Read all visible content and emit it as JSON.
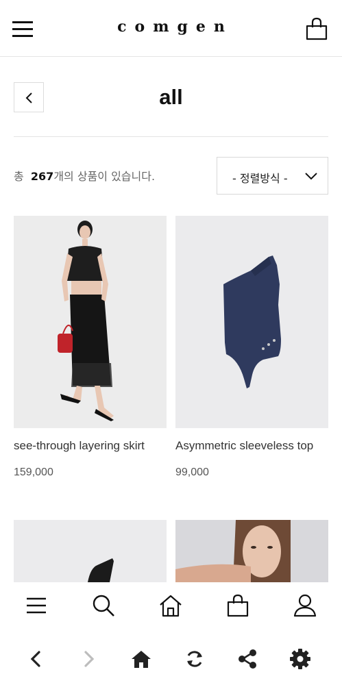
{
  "header": {
    "logo": "comgen"
  },
  "page": {
    "title": "all"
  },
  "listing": {
    "count_prefix": "총",
    "count": "267",
    "count_suffix": "개의 상품이 있습니다.",
    "sort_label": "- 정렬방식 -"
  },
  "products": [
    {
      "name": "see-through layering skirt",
      "price": "159,000"
    },
    {
      "name": "Asymmetric sleeveless top",
      "price": "99,000"
    },
    {
      "name": "",
      "price": ""
    },
    {
      "name": "",
      "price": ""
    }
  ],
  "icons": {
    "menu": "hamburger-menu-icon",
    "cart": "shopping-bag-icon",
    "back": "chevron-left-icon",
    "sort": "chevron-down-icon",
    "bottom_nav": [
      "hamburger-menu-icon",
      "search-icon",
      "home-icon",
      "shopping-bag-icon",
      "user-icon"
    ],
    "browser": [
      "chevron-left-icon",
      "chevron-right-icon",
      "home-icon",
      "refresh-icon",
      "share-icon",
      "gear-icon"
    ]
  },
  "colors": {
    "text": "#111111",
    "muted": "#666666",
    "forward_disabled": "#bdbdbd",
    "image_bg": "#ebebed"
  }
}
